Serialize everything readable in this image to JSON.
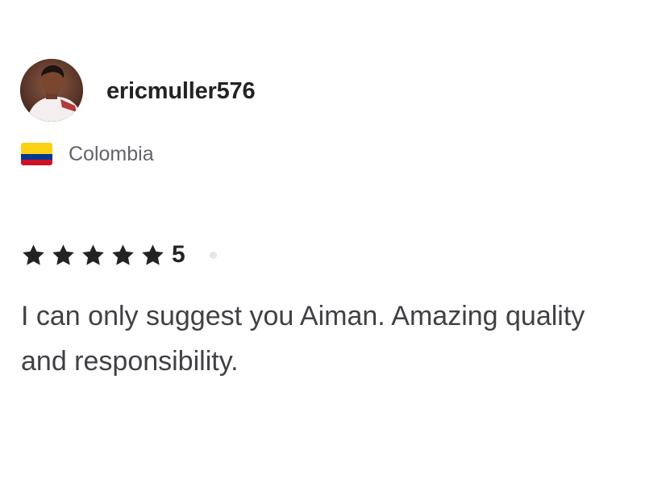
{
  "review": {
    "username": "ericmuller576",
    "avatar_icon": "user-avatar-photo",
    "country": {
      "name": "Colombia",
      "flag_icon": "colombia-flag-icon",
      "flag_colors": [
        "#fcd116",
        "#003893",
        "#ce1126"
      ]
    },
    "rating": {
      "stars": 5,
      "max_stars": 5,
      "value": "5",
      "star_icon": "star-icon",
      "star_color": "#222325"
    },
    "text": "I can only suggest you Aiman. Amazing quality and responsibility."
  }
}
